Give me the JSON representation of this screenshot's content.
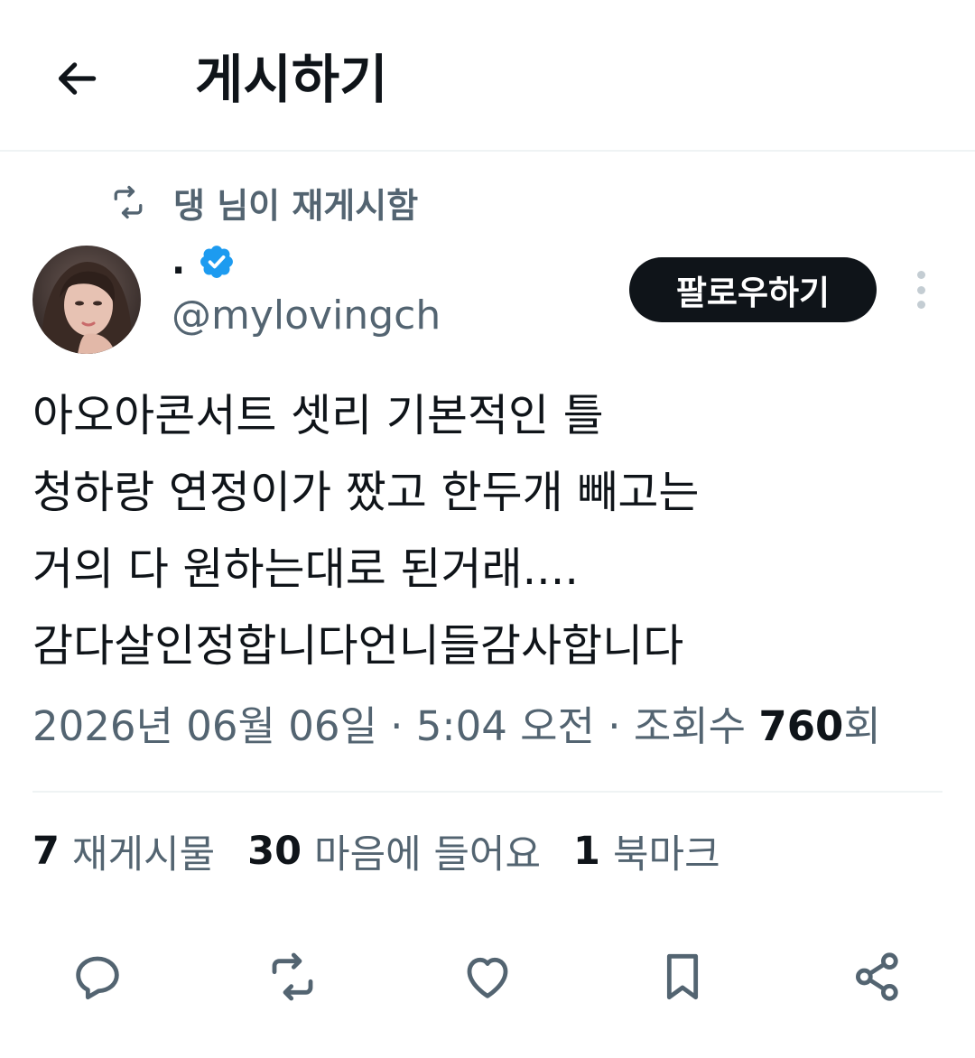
{
  "header": {
    "title": "게시하기"
  },
  "repost": {
    "text": "댕 님이 재게시함"
  },
  "author": {
    "display_name": ".",
    "handle": "@mylovingch",
    "verified": true
  },
  "follow_label": "팔로우하기",
  "tweet": {
    "lines": [
      "아오아콘서트 셋리 기본적인 틀",
      "청하랑 연정이가 짰고 한두개 빼고는",
      "거의 다 원하는대로 된거래....",
      "감다살인정합니다언니들감사합니다"
    ]
  },
  "meta": {
    "date": "2026년 06월 06일",
    "separator": " · ",
    "time": "5:04 오전",
    "views_label": "조회수",
    "views_count": "760",
    "views_suffix": "회"
  },
  "stats": {
    "reposts_count": "7",
    "reposts_label": "재게시물",
    "likes_count": "30",
    "likes_label": "마음에 들어요",
    "bookmarks_count": "1",
    "bookmarks_label": "북마크"
  },
  "colors": {
    "text_primary": "#0f1419",
    "text_secondary": "#536471",
    "verified_blue": "#1d9bf0",
    "divider": "#eff3f4",
    "follow_bg": "#0f1419"
  },
  "icons": {
    "back": "arrow-left-icon",
    "repost_small": "repost-icon",
    "verified": "verified-badge-icon",
    "more": "more-vertical-icon",
    "reply": "reply-icon",
    "repost": "repost-icon",
    "like": "heart-icon",
    "bookmark": "bookmark-icon",
    "share": "share-icon"
  }
}
